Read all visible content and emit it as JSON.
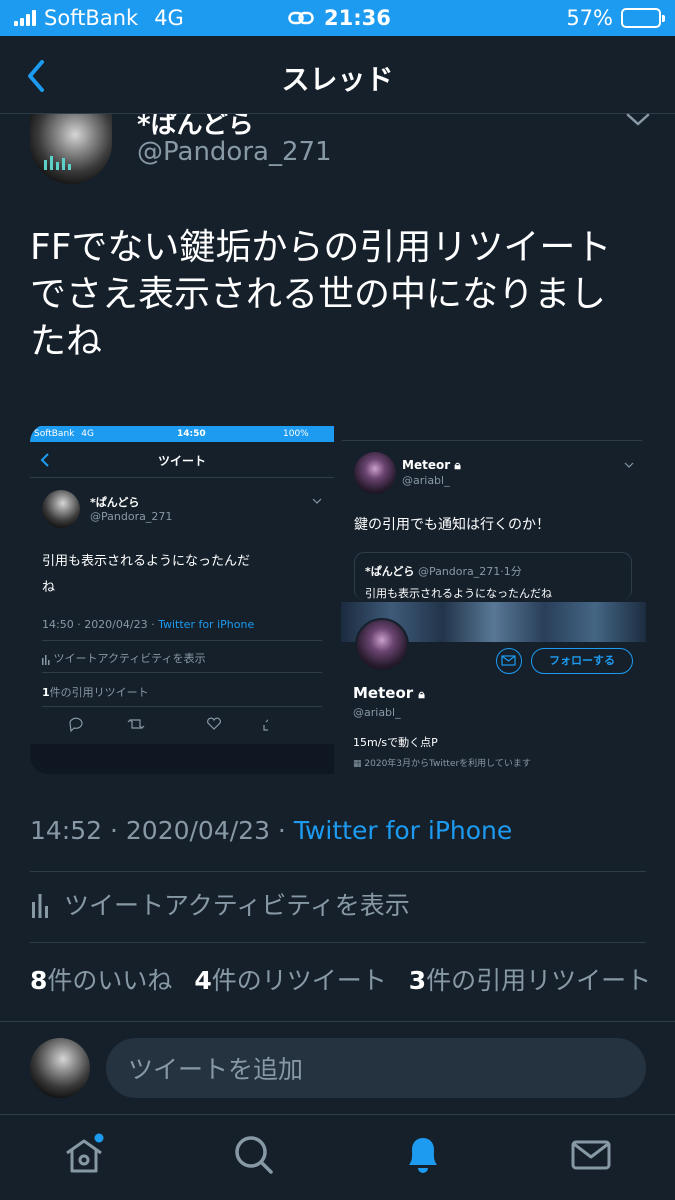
{
  "status_bar": {
    "carrier": "SoftBank",
    "network": "4G",
    "time": "21:36",
    "battery": "57%",
    "battery_level": 0.57
  },
  "nav": {
    "title": "スレッド"
  },
  "tweet": {
    "name": "*ぱんどら",
    "handle": "@Pandora_271",
    "text": [
      "FFでない鍵垢からの引用リツイート",
      "でさえ表示される世の中になりまし",
      "たね"
    ],
    "timestamp": "14:52 · 2020/04/23 · ",
    "source": "Twitter for iPhone",
    "activity_label": "ツイートアクティビティを表示",
    "likes_count": "8",
    "likes_label": "件のいいね",
    "retweets_count": "4",
    "retweets_label": "件のリツイート",
    "quotes_count": "3",
    "quotes_label": "件の引用リツイート"
  },
  "screenshot_left": {
    "carrier": "SoftBank",
    "network": "4G",
    "time": "14:50",
    "battery": "100%",
    "nav_title": "ツイート",
    "name": "*ぱんどら",
    "handle": "@Pandora_271",
    "text_line1": "引用も表示されるようになったんだ",
    "text_line2": "ね",
    "timestamp": "14:50 · 2020/04/23 · ",
    "source": "Twitter for iPhone",
    "activity_label": "ツイートアクティビティを表示",
    "quote_count": "1",
    "quote_label": "件の引用リツイート"
  },
  "screenshot_right": {
    "name": "Meteor",
    "handle": "@ariabl_",
    "text": "鍵の引用でも通知は行くのか！",
    "quote_name": "*ぱんどら",
    "quote_meta": "@Pandora_271·1分",
    "quote_text": "引用も表示されるようになったんだね",
    "follow_label": "フォローする",
    "profile_name": "Meteor",
    "profile_handle": "@ariabl_",
    "bio": "15m/sで動く点P",
    "joined": "2020年3月からTwitterを利用しています"
  },
  "reply": {
    "placeholder": "ツイートを追加"
  },
  "colors": {
    "accent": "#1d9bf0",
    "background": "#15202b",
    "muted": "#8899a6"
  },
  "tabs": [
    "home-icon",
    "search-icon",
    "notifications-icon",
    "messages-icon"
  ]
}
